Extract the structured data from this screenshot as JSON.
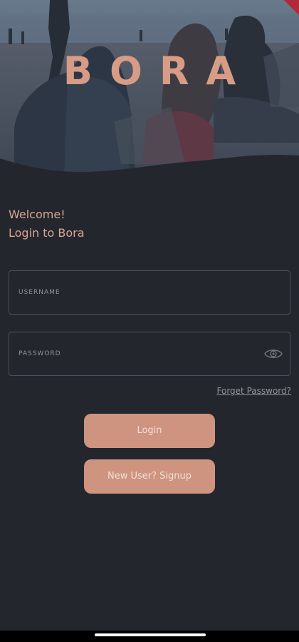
{
  "brand": {
    "logo_text": "BORA"
  },
  "welcome": {
    "line1": "Welcome!",
    "line2": "Login to Bora"
  },
  "form": {
    "username_label": "USERNAME",
    "username_value": "",
    "password_label": "PASSWORD",
    "password_value": "",
    "forgot_link": "Forget Password?"
  },
  "buttons": {
    "login": "Login",
    "signup": "New User? Signup"
  },
  "colors": {
    "background": "#23272d",
    "accent": "#cf9480",
    "text_accent": "#d9a58f",
    "border": "#4b515a"
  },
  "icons": {
    "password_toggle": "eye-icon"
  }
}
